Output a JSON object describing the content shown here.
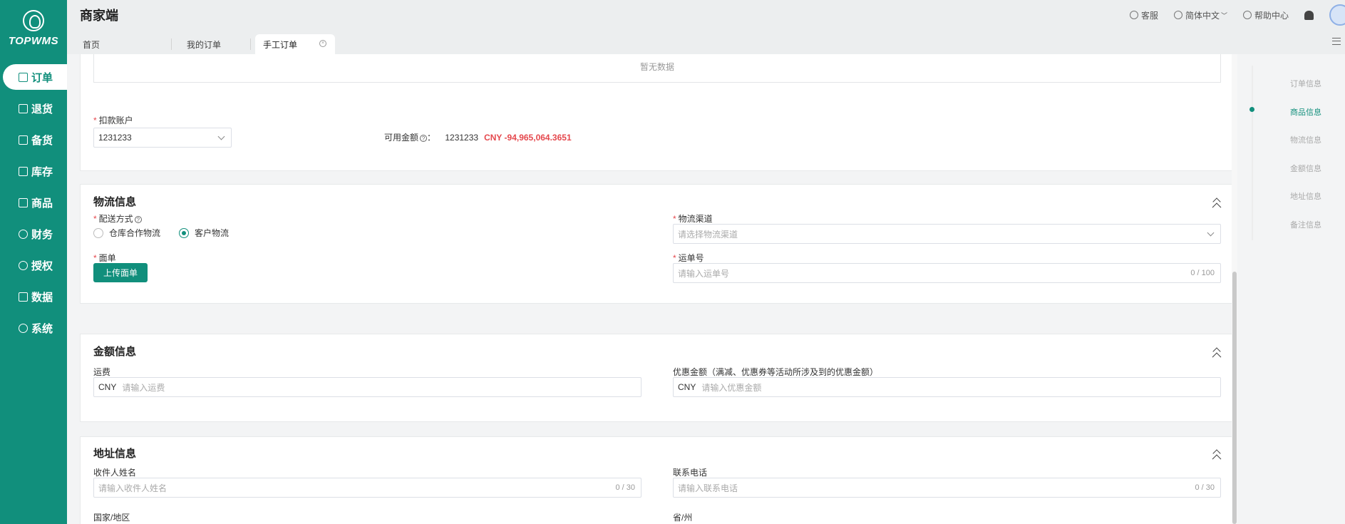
{
  "app": {
    "brand": "TOPWMS",
    "title": "商家端"
  },
  "sidebar": {
    "items": [
      {
        "label": "订单",
        "icon": "order-icon",
        "active": true
      },
      {
        "label": "退货",
        "icon": "return-icon"
      },
      {
        "label": "备货",
        "icon": "stock-prep-icon"
      },
      {
        "label": "库存",
        "icon": "inventory-icon"
      },
      {
        "label": "商品",
        "icon": "product-icon"
      },
      {
        "label": "财务",
        "icon": "finance-icon"
      },
      {
        "label": "授权",
        "icon": "authorize-icon"
      },
      {
        "label": "数据",
        "icon": "data-icon"
      },
      {
        "label": "系统",
        "icon": "system-icon"
      }
    ]
  },
  "header": {
    "service": "客服",
    "language": "简体中文",
    "help": "帮助中心"
  },
  "tabs": [
    {
      "label": "首页"
    },
    {
      "label": "我的订单"
    },
    {
      "label": "手工订单",
      "active": true
    }
  ],
  "product_section": {
    "empty_text": "暂无数据",
    "account_label": "扣款账户",
    "account_value": "1231233",
    "balance_label": "可用金额",
    "balance_account": "1231233",
    "balance_amount": "CNY -94,965,064.3651"
  },
  "logistics": {
    "title": "物流信息",
    "delivery_label": "配送方式",
    "delivery_options": [
      "仓库合作物流",
      "客户物流"
    ],
    "delivery_selected": "客户物流",
    "channel_label": "物流渠道",
    "channel_placeholder": "请选择物流渠道",
    "waybill_label": "面单",
    "upload_button": "上传面单",
    "tracking_label": "运单号",
    "tracking_placeholder": "请输入运单号",
    "tracking_count": "0 / 100"
  },
  "amount": {
    "title": "金额信息",
    "shipping_label": "运费",
    "shipping_prefix": "CNY",
    "shipping_placeholder": "请输入运费",
    "discount_label": "优惠金额（满减、优惠券等活动所涉及到的优惠金额）",
    "discount_prefix": "CNY",
    "discount_placeholder": "请输入优惠金额"
  },
  "address": {
    "title": "地址信息",
    "name_label": "收件人姓名",
    "name_placeholder": "请输入收件人姓名",
    "name_count": "0 / 30",
    "phone_label": "联系电话",
    "phone_placeholder": "请输入联系电话",
    "phone_count": "0 / 30",
    "country_label": "国家/地区",
    "province_label": "省/州"
  },
  "anchor_nav": {
    "items": [
      "订单信息",
      "商品信息",
      "物流信息",
      "金额信息",
      "地址信息",
      "备注信息"
    ],
    "active": "商品信息"
  },
  "colors": {
    "primary": "#118f7c",
    "danger": "#e5484d"
  }
}
